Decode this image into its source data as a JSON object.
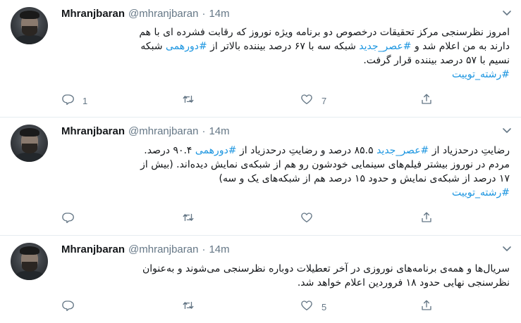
{
  "tweets": [
    {
      "name": "Mhranjbaran",
      "handle": "@mhranjbaran",
      "separator": "·",
      "time": "14m",
      "lines": [
        [
          {
            "t": "امروز نظرسنجی مرکز تحقیقات درخصوص دو برنامه ویژه نوروز که رقابت فشرده ای با هم"
          }
        ],
        [
          {
            "t": "دارند به من اعلام شد و "
          },
          {
            "t": "#عصر_جدید",
            "tag": true
          },
          {
            "t": " شبکه سه با ۶۷ درصد بیننده بالاتر از "
          },
          {
            "t": "#دورهمی",
            "tag": true
          },
          {
            "t": " شبکه"
          }
        ],
        [
          {
            "t": "نسیم با ۵۷ درصد بیننده قرار گرفت."
          }
        ],
        [
          {
            "t": "#رشته_توییت",
            "tag": true
          }
        ]
      ],
      "reply_count": "1",
      "retweet_count": "",
      "like_count": "7"
    },
    {
      "name": "Mhranjbaran",
      "handle": "@mhranjbaran",
      "separator": "·",
      "time": "14m",
      "lines": [
        [
          {
            "t": "رضایتِ درحدزیاد از "
          },
          {
            "t": "#عصر_جدید",
            "tag": true
          },
          {
            "t": " ۸۵.۵ درصد و رضایتِ درحدزیاد  از "
          },
          {
            "t": "#دورهمی",
            "tag": true
          },
          {
            "t": " ۹۰.۴ درصد."
          }
        ],
        [
          {
            "t": "مردم در نوروز بیشتر فیلم‌های سینمایی خودشون رو هم از شبکه‌ی نمایش دیده‌اند. (بیش از"
          }
        ],
        [
          {
            "t": "۱۷ درصد از شبکه‌ی نمایش و حدود ۱۵ درصد هم از شبکه‌های یک و سه)"
          }
        ],
        [
          {
            "t": "#رشته_توییت",
            "tag": true
          }
        ]
      ],
      "reply_count": "",
      "retweet_count": "",
      "like_count": ""
    },
    {
      "name": "Mhranjbaran",
      "handle": "@mhranjbaran",
      "separator": "·",
      "time": "14m",
      "lines": [
        [
          {
            "t": "سریال‌ها و همه‌ی برنامه‌های نوروزی در آخر تعطیلات دوباره نظرسنجی می‌شوند و به‌عنوان"
          }
        ],
        [
          {
            "t": "نظرسنجی نهایی حدود ۱۸ فروردین اعلام خواهد شد."
          }
        ]
      ],
      "reply_count": "",
      "retweet_count": "",
      "like_count": "5"
    }
  ],
  "icons": {
    "caret": "chevron-down-icon",
    "reply": "reply-icon",
    "retweet": "retweet-icon",
    "like": "heart-icon",
    "share": "share-icon"
  },
  "colors": {
    "hashtag": "#1b95e0",
    "muted": "#657786",
    "text": "#14171a",
    "divider": "#e6ecf0"
  }
}
